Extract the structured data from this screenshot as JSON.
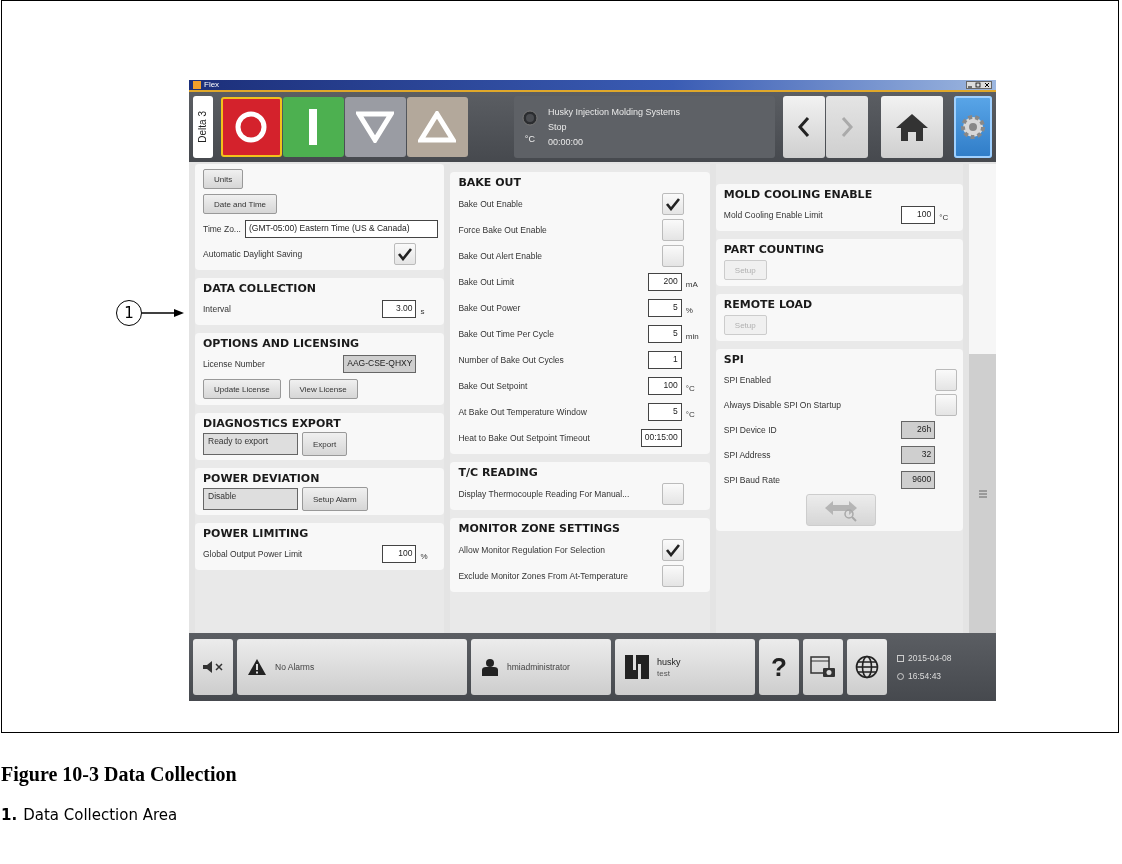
{
  "window": {
    "title": "Flex"
  },
  "toolbar": {
    "machine": "Delta 3",
    "mode_buttons": [
      {
        "kind": "stop",
        "selected": true
      },
      {
        "kind": "start",
        "selected": false
      },
      {
        "kind": "down",
        "selected": false
      },
      {
        "kind": "up",
        "selected": false
      }
    ],
    "status": {
      "unit": "°C",
      "company": "Husky Injection Molding Systems",
      "state": "Stop",
      "time": "00:00:00"
    },
    "nav_buttons": [
      {
        "kind": "back",
        "disabled": false,
        "selected": false
      },
      {
        "kind": "forward",
        "disabled": true,
        "selected": false
      },
      {
        "kind": "home",
        "disabled": false,
        "selected": false
      },
      {
        "kind": "settings",
        "disabled": false,
        "selected": true
      }
    ]
  },
  "columns": [
    {
      "sections": [
        {
          "rows": [
            {
              "kind": "buttons",
              "buttons": [
                {
                  "label": "Units",
                  "disabled": false
                }
              ]
            },
            {
              "kind": "buttons",
              "buttons": [
                {
                  "label": "Date and Time",
                  "disabled": false
                }
              ]
            },
            {
              "kind": "select",
              "label": "Time Zo...",
              "value": "(GMT-05:00) Eastern Time (US & Canada)"
            },
            {
              "kind": "check",
              "label": "Automatic Daylight Saving",
              "checked": true
            }
          ]
        },
        {
          "title": "DATA COLLECTION",
          "rows": [
            {
              "kind": "field",
              "label": "Interval",
              "value": "3.00",
              "unit": "s",
              "readonly": false
            }
          ]
        },
        {
          "title": "OPTIONS AND LICENSING",
          "rows": [
            {
              "kind": "field",
              "label": "License Number",
              "value": "AAG-CSE-QHXY",
              "readonly": true
            },
            {
              "kind": "buttons",
              "buttons": [
                {
                  "label": "Update License",
                  "disabled": false
                },
                {
                  "label": "View License",
                  "disabled": false
                }
              ]
            }
          ]
        },
        {
          "title": "DIAGNOSTICS EXPORT",
          "rows": [
            {
              "kind": "status",
              "value": "Ready to export",
              "button": "Export"
            }
          ]
        },
        {
          "title": "POWER DEVIATION",
          "rows": [
            {
              "kind": "status",
              "value": "Disable",
              "button": "Setup Alarm"
            }
          ]
        },
        {
          "title": "POWER LIMITING",
          "rows": [
            {
              "kind": "field",
              "label": "Global Output Power Limit",
              "value": "100",
              "unit": "%",
              "readonly": false
            }
          ]
        }
      ]
    },
    {
      "sections": [
        {
          "title": "BAKE OUT",
          "rows": [
            {
              "kind": "check",
              "label": "Bake Out Enable",
              "checked": true
            },
            {
              "kind": "check",
              "label": "Force Bake Out Enable",
              "checked": false
            },
            {
              "kind": "check",
              "label": "Bake Out Alert Enable",
              "checked": false
            },
            {
              "kind": "field",
              "label": "Bake Out Limit",
              "value": "200",
              "unit": "mA",
              "readonly": false
            },
            {
              "kind": "field",
              "label": "Bake Out Power",
              "value": "5",
              "unit": "%",
              "readonly": false
            },
            {
              "kind": "field",
              "label": "Bake Out Time Per Cycle",
              "value": "5",
              "unit": "min",
              "readonly": false
            },
            {
              "kind": "field",
              "label": "Number of Bake Out Cycles",
              "value": "1",
              "readonly": false
            },
            {
              "kind": "field",
              "label": "Bake Out Setpoint",
              "value": "100",
              "unit": "°C",
              "readonly": false
            },
            {
              "kind": "field",
              "label": "At Bake Out Temperature Window",
              "value": "5",
              "unit": "°C",
              "readonly": false
            },
            {
              "kind": "field",
              "label": "Heat to Bake Out Setpoint Timeout",
              "value": "00:15:00",
              "readonly": false
            }
          ]
        },
        {
          "title": "T/C READING",
          "rows": [
            {
              "kind": "check",
              "label": "Display Thermocouple Reading For Manual...",
              "checked": false
            }
          ]
        },
        {
          "title": "MONITOR ZONE SETTINGS",
          "rows": [
            {
              "kind": "check",
              "label": "Allow Monitor Regulation For Selection",
              "checked": true
            },
            {
              "kind": "check",
              "label": "Exclude Monitor Zones From At-Temperature",
              "checked": false
            }
          ]
        }
      ]
    },
    {
      "sections": [
        {
          "title": "MOLD COOLING ENABLE",
          "rows": [
            {
              "kind": "field",
              "label": "Mold Cooling Enable Limit",
              "value": "100",
              "unit": "°C",
              "readonly": false
            }
          ]
        },
        {
          "title": "PART COUNTING",
          "rows": [
            {
              "kind": "buttons",
              "buttons": [
                {
                  "label": "Setup",
                  "disabled": true
                }
              ]
            }
          ]
        },
        {
          "title": "REMOTE LOAD",
          "rows": [
            {
              "kind": "buttons",
              "buttons": [
                {
                  "label": "Setup",
                  "disabled": true
                }
              ]
            }
          ]
        },
        {
          "title": "SPI",
          "rows": [
            {
              "kind": "check",
              "label": "SPI Enabled",
              "checked": false
            },
            {
              "kind": "check",
              "label": "Always Disable SPI On Startup",
              "checked": false
            },
            {
              "kind": "field",
              "label": "SPI Device ID",
              "value": "26h",
              "readonly": true
            },
            {
              "kind": "field",
              "label": "SPI Address",
              "value": "32",
              "readonly": true
            },
            {
              "kind": "field",
              "label": "SPI Baud Rate",
              "value": "9600",
              "readonly": true
            },
            {
              "kind": "tool",
              "disabled": true
            }
          ]
        }
      ]
    }
  ],
  "status_bar": {
    "alarms": "No Alarms",
    "user": "hmiadministrator",
    "brand": "husky",
    "brand_sub": "test",
    "help": "?",
    "date": "2015-04-08",
    "time": "16:54:43"
  },
  "figure": {
    "callout": "1",
    "caption": "Figure 10-3 Data Collection",
    "legend": [
      {
        "number": "1.",
        "text": "Data Collection Area"
      }
    ]
  }
}
